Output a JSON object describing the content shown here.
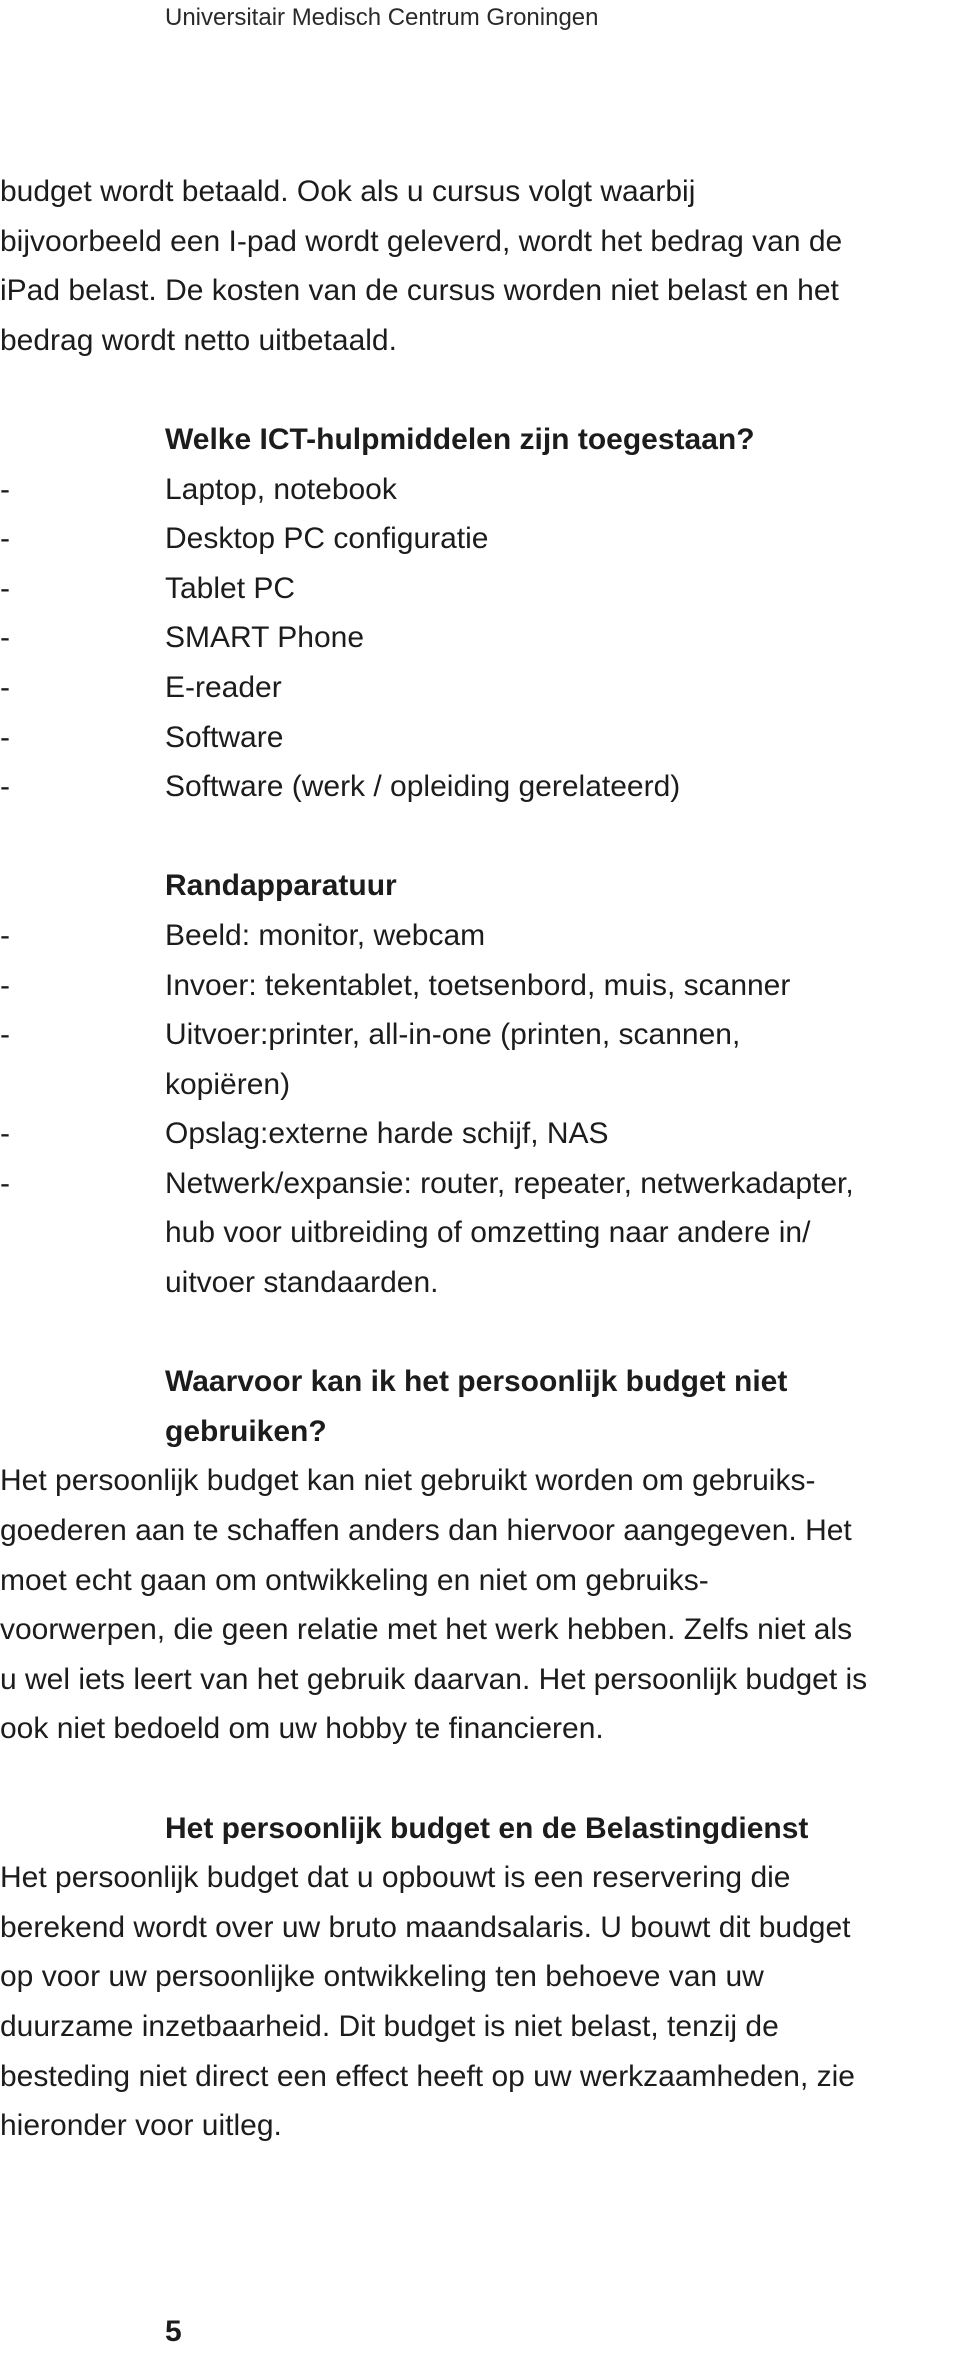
{
  "running_header": "Universitair Medisch Centrum Groningen",
  "intro_paragraph": {
    "lines": [
      "budget wordt betaald. Ook als u cursus volgt waarbij",
      "bijvoorbeeld een I-pad wordt geleverd, wordt het bedrag van de",
      "iPad belast. De kosten van de cursus worden niet belast en het",
      "bedrag wordt netto uitbetaald."
    ]
  },
  "allowed_ict": {
    "heading": "Welke ICT-hulpmiddelen zijn toegestaan?",
    "bullet": "-",
    "items": [
      {
        "lines": [
          "Laptop, notebook"
        ]
      },
      {
        "lines": [
          "Desktop PC configuratie"
        ]
      },
      {
        "lines": [
          "Tablet PC"
        ]
      },
      {
        "lines": [
          "SMART Phone"
        ]
      },
      {
        "lines": [
          "E-reader"
        ]
      },
      {
        "lines": [
          "Software"
        ]
      },
      {
        "lines": [
          "Software (werk / opleiding gerelateerd)"
        ]
      }
    ]
  },
  "peripherals": {
    "heading": "Randapparatuur",
    "bullet": "-",
    "items": [
      {
        "lines": [
          "Beeld: monitor, webcam"
        ]
      },
      {
        "lines": [
          "Invoer: tekentablet, toetsenbord, muis, scanner"
        ]
      },
      {
        "lines": [
          "Uitvoer:printer, all-in-one (printen, scannen,",
          "kopiëren)"
        ]
      },
      {
        "lines": [
          "Opslag:externe harde schijf, NAS"
        ]
      },
      {
        "lines": [
          "Netwerk/expansie: router, repeater, netwerkadapter,",
          "hub voor uitbreiding of omzetting naar andere in/",
          "uitvoer standaarden."
        ]
      }
    ]
  },
  "not_allowed": {
    "heading_lines": [
      "Waarvoor kan ik het persoonlijk budget niet",
      "gebruiken?"
    ],
    "lines": [
      "Het persoonlijk budget kan niet gebruikt worden om gebruiks-",
      "goederen aan te schaffen anders dan hiervoor aangegeven. Het",
      "moet echt gaan om ontwikkeling en niet om gebruiks-",
      "voorwerpen, die geen relatie met het werk hebben. Zelfs niet als",
      "u wel iets leert van het gebruik daarvan. Het persoonlijk budget is",
      "ook niet bedoeld om uw hobby te financieren."
    ]
  },
  "tax": {
    "heading": "Het persoonlijk budget en de Belastingdienst",
    "lines": [
      "Het persoonlijk budget dat u opbouwt is een reservering die",
      "berekend wordt over uw bruto maandsalaris. U bouwt dit budget",
      "op voor uw persoonlijke ontwikkeling ten behoeve van uw",
      "duurzame inzetbaarheid. Dit budget is niet belast, tenzij de",
      "besteding niet direct een effect heeft op uw werkzaamheden, zie",
      "hieronder voor uitleg."
    ]
  },
  "page_number": "5"
}
